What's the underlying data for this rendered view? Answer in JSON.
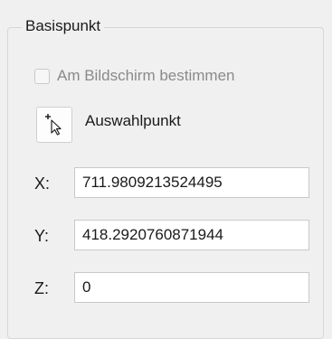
{
  "group": {
    "title": "Basispunkt"
  },
  "screen_pick": {
    "label": "Am Bildschirm bestimmen",
    "checked": false,
    "enabled": false
  },
  "pick_point": {
    "icon": "cursor-plus-icon",
    "label": "Auswahlpunkt"
  },
  "coordinates": {
    "x_label": "X:",
    "x_value": "711.9809213524495",
    "y_label": "Y:",
    "y_value": "418.2920760871944",
    "z_label": "Z:",
    "z_value": "0"
  }
}
